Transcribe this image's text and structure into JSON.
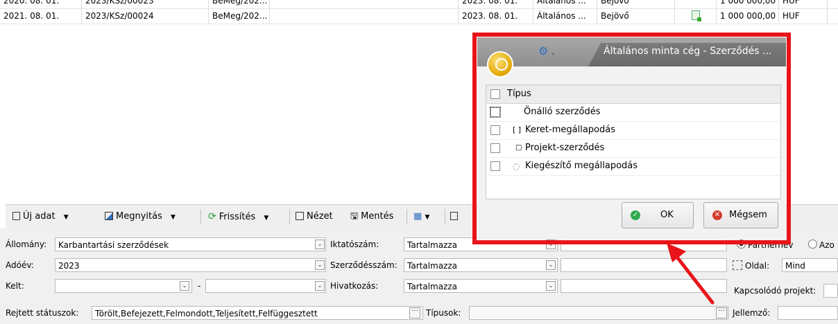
{
  "grid": {
    "partial_row": [
      "2020. 08. 01.",
      "2023/KSz/00023",
      "BeMeg/202...",
      "2023. 08. 01.",
      "Általános ...",
      "Bejövő",
      "",
      "1 000 000,00",
      "HUF"
    ],
    "row": [
      "2021. 08. 01.",
      "2023/KSz/00024",
      "BeMeg/202...",
      "2023. 08. 01.",
      "Általános ...",
      "Bejövő",
      "",
      "1 000 000,00",
      "HUF"
    ]
  },
  "toolbar": {
    "new_label": "Új adat",
    "open_label": "Megnyitás",
    "refresh_label": "Frissítés",
    "view_label": "Nézet",
    "save_label": "Mentés"
  },
  "filter": {
    "allomany_label": "Állomány:",
    "allomany_value": "Karbantartási szerződések",
    "adoev_label": "Adóév:",
    "adoev_value": "2023",
    "kelt_label": "Kelt:",
    "kelt_sep": "-",
    "rejtett_label": "Rejtett státuszok:",
    "rejtett_value": "Törölt,Befejezett,Felmondott,Teljesített,Felfüggesztett",
    "iktato_label": "Iktatószám:",
    "iktato_value": "Tartalmazza",
    "szerzodes_label": "Szerződésszám:",
    "szerzodes_value": "Tartalmazza",
    "hivatkozas_label": "Hivatkozás:",
    "hivatkozas_value": "Tartalmazza",
    "tipusok_label": "Típusok:",
    "partner_label": "Partnernév",
    "azo_label": "Azo",
    "oldal_label": "Oldal:",
    "oldal_value": "Mind",
    "kapcs_label": "Kapcsolódó projekt:",
    "jellemzo_label": "Jellemző:"
  },
  "dialog": {
    "title": "Általános minta cég - Szerződés ...",
    "header": "Típus",
    "items": [
      "Önálló szerződés",
      "Keret-megállapodás",
      "Projekt-szerződés",
      "Kiegészítő megállapodás"
    ],
    "ok_label": "OK",
    "cancel_label": "Mégsem"
  },
  "colors": {
    "highlight": "#e8141a",
    "titlebar": "#8e8e8e",
    "accent": "#2e6fc0"
  }
}
